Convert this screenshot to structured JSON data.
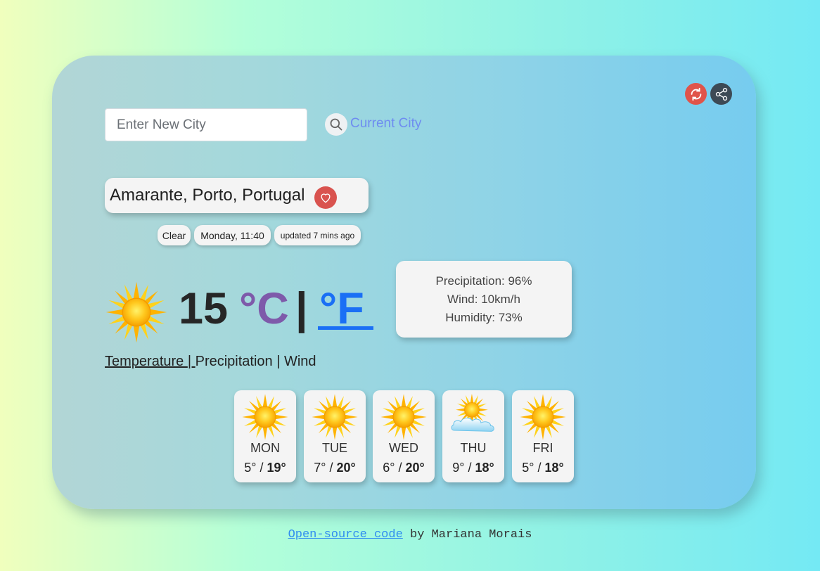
{
  "search": {
    "placeholder": "Enter New City",
    "current_city_label": "Current City"
  },
  "location": {
    "name": "Amarante, Porto, Portugal"
  },
  "status": {
    "condition": "Clear",
    "datetime": "Monday, 11:40",
    "updated": "updated 7 mins ago"
  },
  "current": {
    "icon": "sun-icon",
    "temperature": "15",
    "unit_c": "°C",
    "separator": "|",
    "unit_f": "°F",
    "selected_unit": "°F"
  },
  "details": {
    "precipitation": "Precipitation: 96%",
    "wind": "Wind: 10km/h",
    "humidity": "Humidity: 73%"
  },
  "chart_tabs": {
    "temperature": "Temperature ",
    "sep1": "| ",
    "precipitation": "Precipitation",
    "sep2": " | ",
    "wind": "Wind",
    "active": "Temperature"
  },
  "forecast": [
    {
      "day": "MON",
      "min": "5°",
      "max": "19°",
      "icon": "sun-icon"
    },
    {
      "day": "TUE",
      "min": "7°",
      "max": "20°",
      "icon": "sun-icon"
    },
    {
      "day": "WED",
      "min": "6°",
      "max": "20°",
      "icon": "sun-icon"
    },
    {
      "day": "THU",
      "min": "9°",
      "max": "18°",
      "icon": "sun-behind-cloud-icon"
    },
    {
      "day": "FRI",
      "min": "5°",
      "max": "18°",
      "icon": "sun-icon"
    }
  ],
  "footer": {
    "link_text": "Open-source code",
    "suffix": " by Mariana Morais"
  },
  "colors": {
    "accent_blue": "#1a6ff5",
    "accent_purple": "#7e5aaa",
    "refresh": "#e0544a",
    "share": "#3d4a55"
  }
}
